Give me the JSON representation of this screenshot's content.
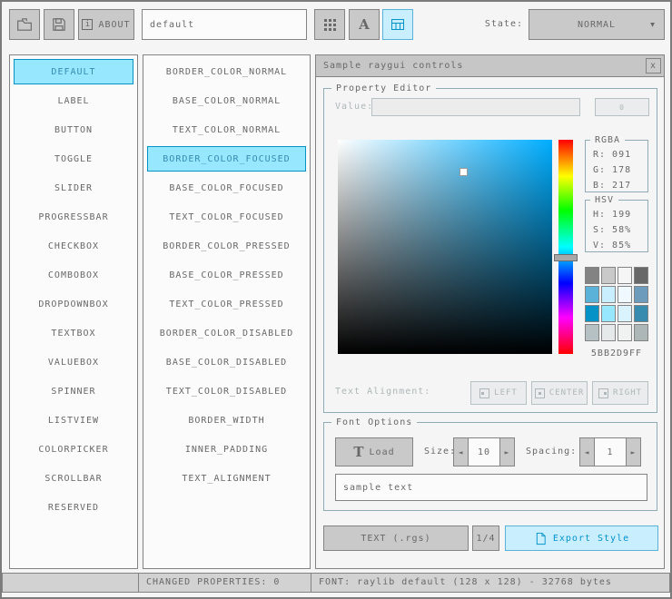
{
  "colors": {
    "background": "#f5f5f5",
    "border_normal": "#838383",
    "base_normal": "#c9c9c9",
    "text_normal": "#686868",
    "border_focused": "#5bb2d9",
    "base_focused": "#c9effe",
    "border_pressed": "#0492c7",
    "base_pressed": "#97e8ff",
    "text_pressed": "#368baf",
    "border_disabled": "#b5c1c2",
    "base_disabled": "#e6e9e9",
    "text_disabled": "#aeb7b8",
    "line": "#90abb5"
  },
  "icons": {
    "info": "i",
    "close": "x",
    "dropdown_arrow": "▼",
    "spinner_left": "◄",
    "spinner_right": "►",
    "font_load": "T",
    "font_tool": "A"
  },
  "toolbar": {
    "about_label": "ABOUT",
    "style_name_value": "default",
    "state_label": "State:",
    "state_value": "NORMAL"
  },
  "controls": {
    "selected_index": 0,
    "items": [
      "DEFAULT",
      "LABEL",
      "BUTTON",
      "TOGGLE",
      "SLIDER",
      "PROGRESSBAR",
      "CHECKBOX",
      "COMBOBOX",
      "DROPDOWNBOX",
      "TEXTBOX",
      "VALUEBOX",
      "SPINNER",
      "LISTVIEW",
      "COLORPICKER",
      "SCROLLBAR",
      "RESERVED"
    ]
  },
  "properties": {
    "selected_index": 3,
    "items": [
      "BORDER_COLOR_NORMAL",
      "BASE_COLOR_NORMAL",
      "TEXT_COLOR_NORMAL",
      "BORDER_COLOR_FOCUSED",
      "BASE_COLOR_FOCUSED",
      "TEXT_COLOR_FOCUSED",
      "BORDER_COLOR_PRESSED",
      "BASE_COLOR_PRESSED",
      "TEXT_COLOR_PRESSED",
      "BORDER_COLOR_DISABLED",
      "BASE_COLOR_DISABLED",
      "TEXT_COLOR_DISABLED",
      "BORDER_WIDTH",
      "INNER_PADDING",
      "TEXT_ALIGNMENT"
    ]
  },
  "sample_window": {
    "title": "Sample raygui controls",
    "property_editor": {
      "label": "Property Editor",
      "value_label": "Value:",
      "value_input": "",
      "value_button_label": "0",
      "rgba_label": "RGBA",
      "rgba": {
        "r": "R:  091",
        "g": "G:  178",
        "b": "B:  217"
      },
      "hsv_label": "HSV",
      "hsv": {
        "h": "H:  199",
        "s": "S:  58%",
        "v": "V:  85%"
      },
      "palette": [
        "#838383",
        "#c9c9c9",
        "#f5f5f5",
        "#686868",
        "#5bb2d9",
        "#c9effe",
        "#eff9ff",
        "#6c9bbc",
        "#0492c7",
        "#97e8ff",
        "#d9f4ff",
        "#368baf",
        "#b5c1c2",
        "#e6e9e9",
        "#f0f1f1",
        "#aeb7b8"
      ],
      "hex_value": "5BB2D9FF",
      "text_alignment_label": "Text Alignment:",
      "align_buttons": [
        "LEFT",
        "CENTER",
        "RIGHT"
      ]
    },
    "font_options": {
      "label": "Font Options",
      "load_button": "Load",
      "size_label": "Size:",
      "size_value": "10",
      "spacing_label": "Spacing:",
      "spacing_value": "1",
      "sample_text": "sample text"
    },
    "footer": {
      "export_text_button": "TEXT (.rgs)",
      "format_button": "1/4",
      "export_style_button": "Export Style"
    }
  },
  "statusbar": {
    "left": "",
    "changed_properties": "CHANGED PROPERTIES: 0",
    "font_info": "FONT: raylib default (128 x 128) - 32768 bytes"
  }
}
